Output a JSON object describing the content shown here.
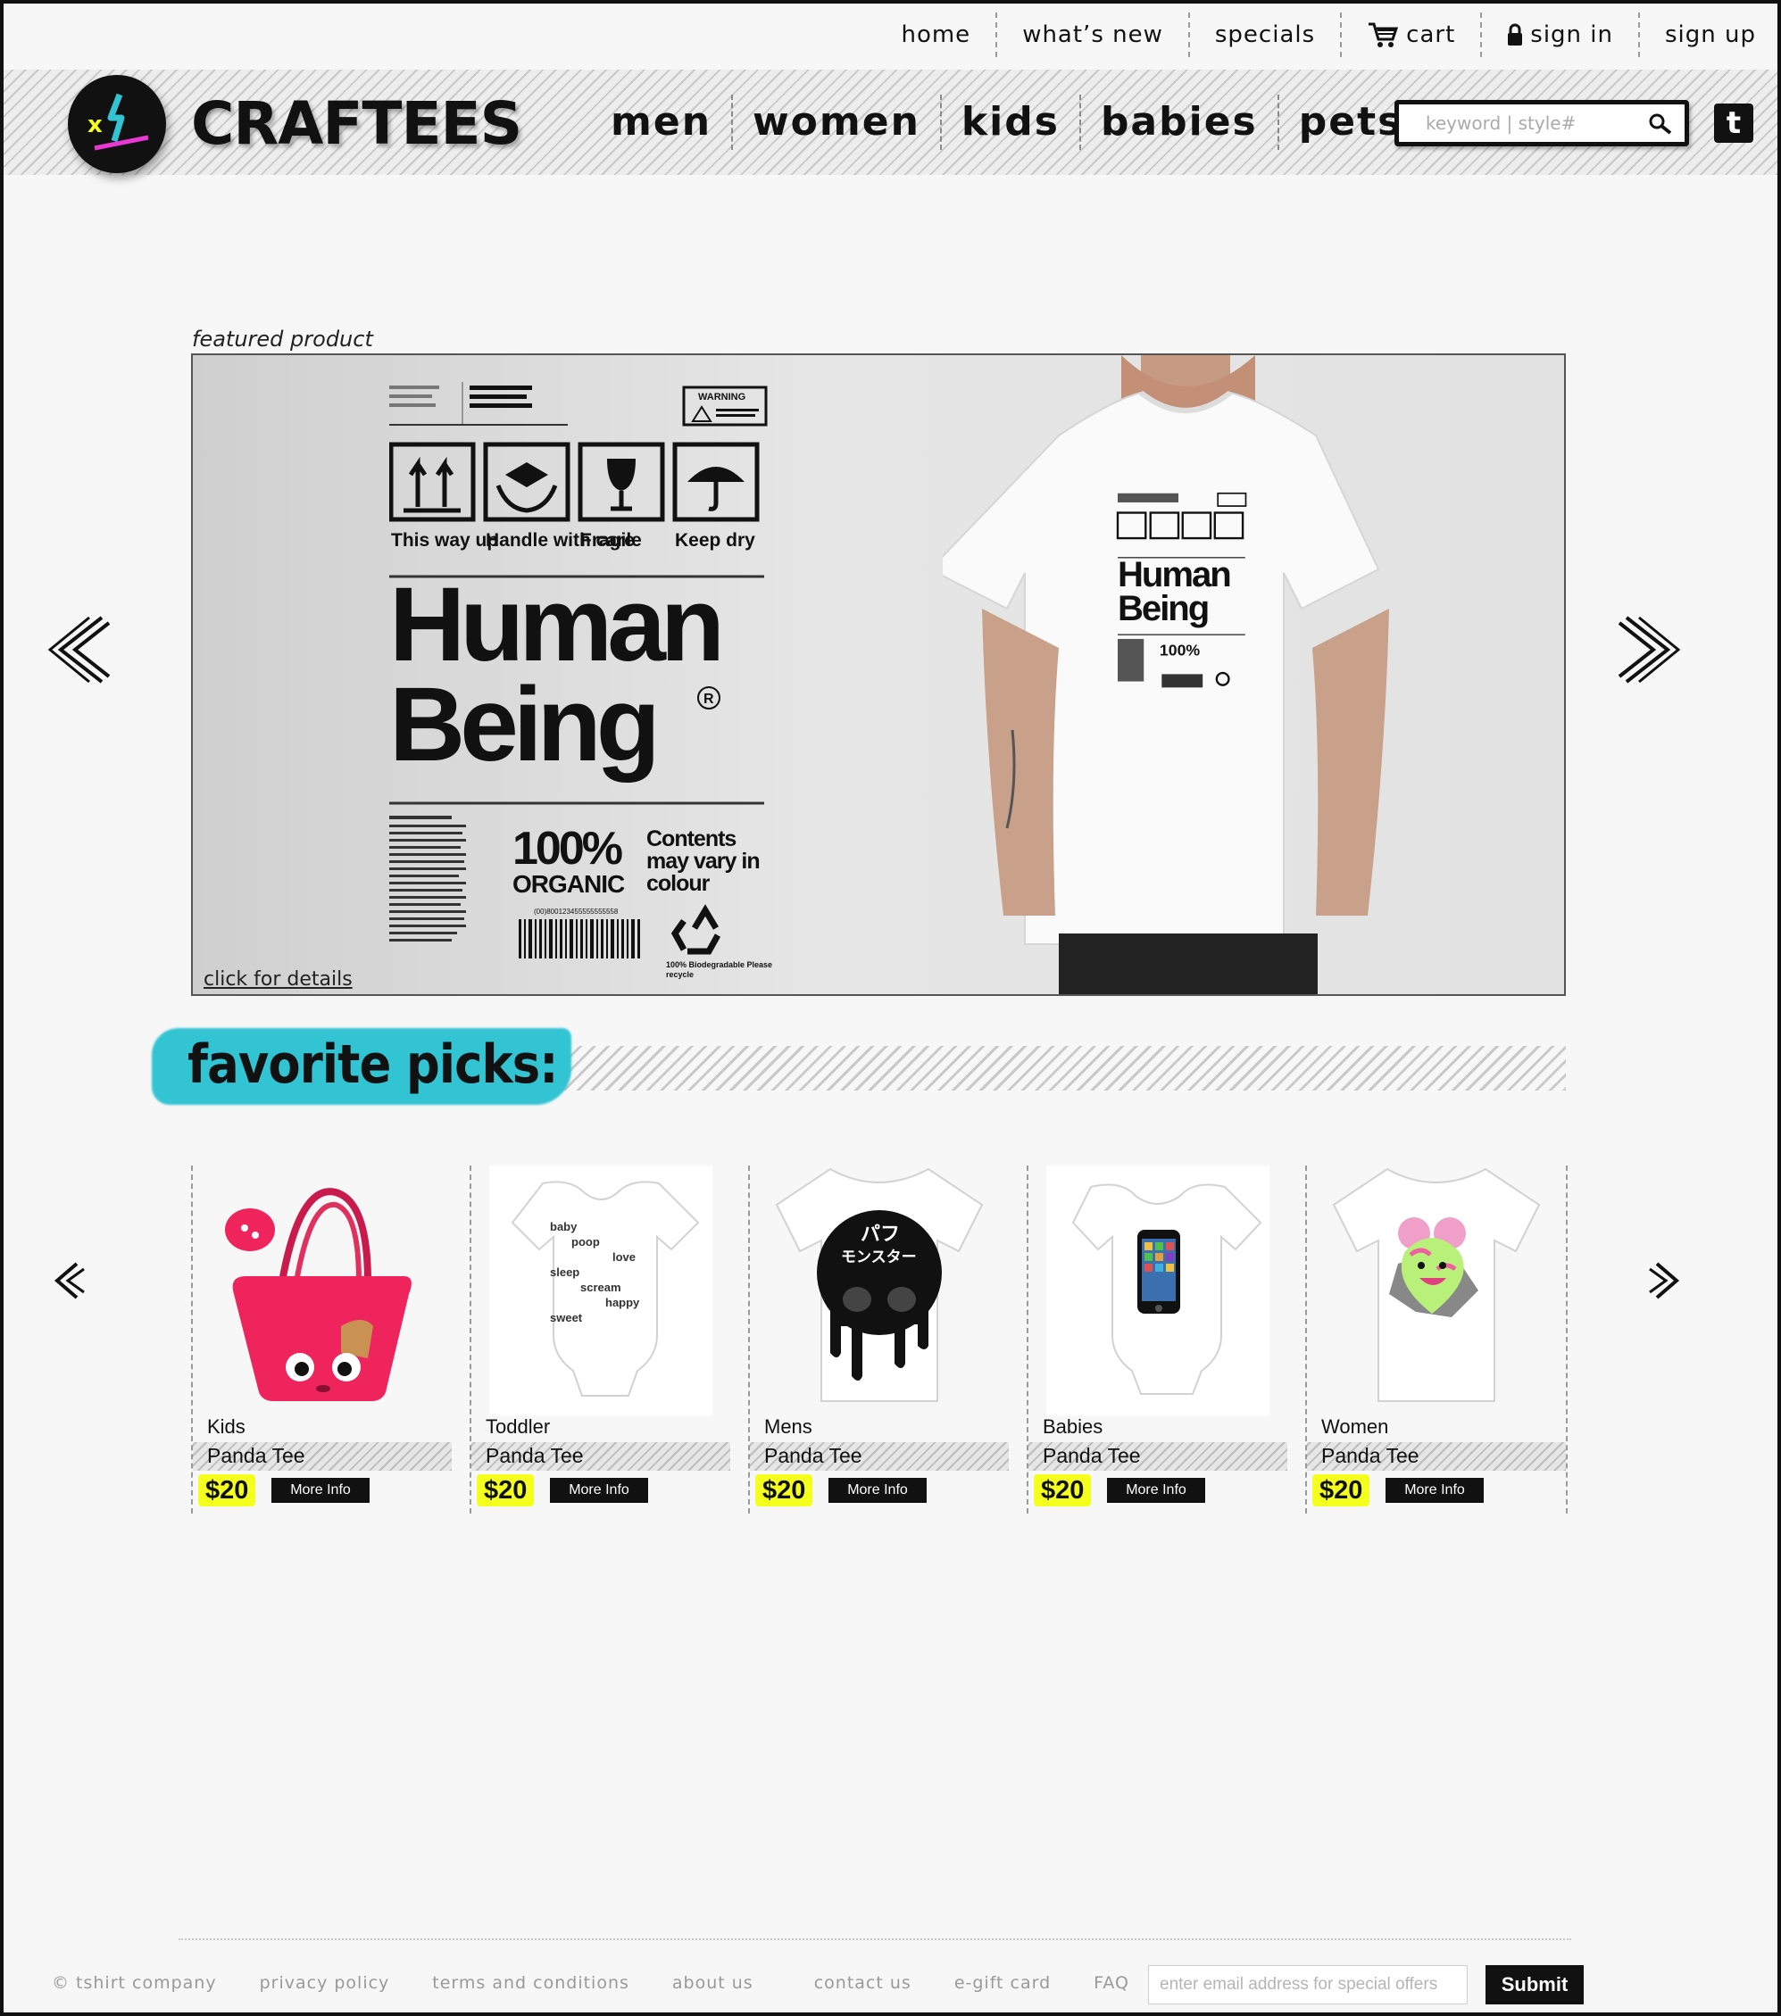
{
  "topnav": {
    "home": "home",
    "whats_new": "what’s new",
    "specials": "specials",
    "cart": "cart",
    "sign_in": "sign in",
    "sign_up": "sign up"
  },
  "brand": {
    "name": "CRAFTEES"
  },
  "categories": [
    "men",
    "women",
    "kids",
    "babies",
    "pets"
  ],
  "search": {
    "placeholder": "keyword | style#"
  },
  "featured": {
    "label": "featured product",
    "link": "click for details",
    "shirt": {
      "headline_1": "Human",
      "headline_2": "Being",
      "icon_labels": [
        "This way up",
        "Handle with care",
        "Fragile",
        "Keep dry"
      ],
      "organic_1": "100%",
      "organic_2": "ORGANIC",
      "contents": "Contents may vary in colour",
      "warning": "WARNING",
      "barcode": "(00)800123455555555558",
      "recycle": "100% Biodegradable Please recycle"
    }
  },
  "favorites": {
    "title": "favorite picks:",
    "items": [
      {
        "category": "Kids",
        "name": "Panda Tee",
        "price": "$20",
        "more": "More Info"
      },
      {
        "category": "Toddler",
        "name": "Panda Tee",
        "price": "$20",
        "more": "More Info"
      },
      {
        "category": "Mens",
        "name": "Panda Tee",
        "price": "$20",
        "more": "More Info"
      },
      {
        "category": "Babies",
        "name": "Panda Tee",
        "price": "$20",
        "more": "More Info"
      },
      {
        "category": "Women",
        "name": "Panda Tee",
        "price": "$20",
        "more": "More Info"
      }
    ],
    "onesie_words": [
      "baby",
      "poop",
      "love",
      "sleep",
      "scream",
      "happy",
      "sweet"
    ],
    "skull_text_1": "パフ",
    "skull_text_2": "モンスター"
  },
  "footer": {
    "links": [
      "© tshirt company",
      "privacy policy",
      "terms and conditions",
      "about us",
      "contact us",
      "e-gift card",
      "FAQ"
    ],
    "email_placeholder": "enter email address for special offers",
    "submit": "Submit"
  },
  "colors": {
    "accent_cyan": "#33c4d4",
    "price_yellow": "#f4ff1e",
    "kids_bag_pink": "#f0245c"
  }
}
